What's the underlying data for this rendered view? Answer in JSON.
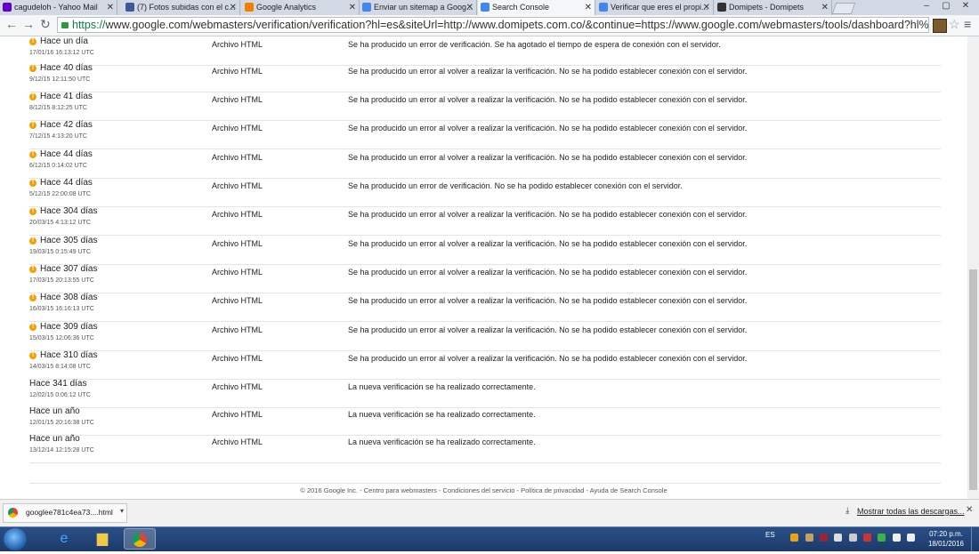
{
  "browser": {
    "tabs": [
      {
        "title": "cagudeloh - Yahoo Mail",
        "color": "#6001d2"
      },
      {
        "title": "(7) Fotos subidas con el c...",
        "color": "#3b5998"
      },
      {
        "title": "Google Analytics",
        "color": "#f57c00"
      },
      {
        "title": "Enviar un sitemap a Goog...",
        "color": "#4285f4"
      },
      {
        "title": "Search Console",
        "color": "#4285f4",
        "active": true
      },
      {
        "title": "Verificar que eres el propi...",
        "color": "#4285f4"
      },
      {
        "title": "Domipets - Domipets",
        "color": "#333333"
      }
    ],
    "url_scheme": "https://",
    "url_rest": "www.google.com/webmasters/verification/verification?hl=es&siteUrl=http://www.domipets.com.co/&continue=https://www.google.com/webmasters/tools/dashboard?hl%3Des%26authuser%"
  },
  "history": [
    {
      "warn": true,
      "age": "Hace un día",
      "ts": "17/01/16 16:13:12 UTC",
      "method": "Archivo HTML",
      "result": "Se ha producido un error de verificación. Se ha agotado el tiempo de espera de conexión con el servidor."
    },
    {
      "warn": true,
      "age": "Hace 40 días",
      "ts": "9/12/15 12:11:50 UTC",
      "method": "Archivo HTML",
      "result": "Se ha producido un error al volver a realizar la verificación. No se ha podido establecer conexión con el servidor."
    },
    {
      "warn": true,
      "age": "Hace 41 días",
      "ts": "8/12/15 8:12:25 UTC",
      "method": "Archivo HTML",
      "result": "Se ha producido un error al volver a realizar la verificación. No se ha podido establecer conexión con el servidor."
    },
    {
      "warn": true,
      "age": "Hace 42 días",
      "ts": "7/12/15 4:13:20 UTC",
      "method": "Archivo HTML",
      "result": "Se ha producido un error al volver a realizar la verificación. No se ha podido establecer conexión con el servidor."
    },
    {
      "warn": true,
      "age": "Hace 44 días",
      "ts": "6/12/15 0:14:02 UTC",
      "method": "Archivo HTML",
      "result": "Se ha producido un error al volver a realizar la verificación. No se ha podido establecer conexión con el servidor."
    },
    {
      "warn": true,
      "age": "Hace 44 días",
      "ts": "5/12/15 22:00:08 UTC",
      "method": "Archivo HTML",
      "result": "Se ha producido un error de verificación. No se ha podido establecer conexión con el servidor."
    },
    {
      "warn": true,
      "age": "Hace 304 días",
      "ts": "20/03/15 4:13:12 UTC",
      "method": "Archivo HTML",
      "result": "Se ha producido un error al volver a realizar la verificación. No se ha podido establecer conexión con el servidor."
    },
    {
      "warn": true,
      "age": "Hace 305 días",
      "ts": "19/03/15 0:15:49 UTC",
      "method": "Archivo HTML",
      "result": "Se ha producido un error al volver a realizar la verificación. No se ha podido establecer conexión con el servidor."
    },
    {
      "warn": true,
      "age": "Hace 307 días",
      "ts": "17/03/15 20:13:55 UTC",
      "method": "Archivo HTML",
      "result": "Se ha producido un error al volver a realizar la verificación. No se ha podido establecer conexión con el servidor."
    },
    {
      "warn": true,
      "age": "Hace 308 días",
      "ts": "16/03/15 16:16:13 UTC",
      "method": "Archivo HTML",
      "result": "Se ha producido un error al volver a realizar la verificación. No se ha podido establecer conexión con el servidor."
    },
    {
      "warn": true,
      "age": "Hace 309 días",
      "ts": "15/03/15 12:06:36 UTC",
      "method": "Archivo HTML",
      "result": "Se ha producido un error al volver a realizar la verificación. No se ha podido establecer conexión con el servidor."
    },
    {
      "warn": true,
      "age": "Hace 310 días",
      "ts": "14/03/15 8:14:08 UTC",
      "method": "Archivo HTML",
      "result": "Se ha producido un error al volver a realizar la verificación. No se ha podido establecer conexión con el servidor."
    },
    {
      "warn": false,
      "age": "Hace 341 días",
      "ts": "12/02/15 0:06:12 UTC",
      "method": "Archivo HTML",
      "result": "La nueva verificación se ha realizado correctamente."
    },
    {
      "warn": false,
      "age": "Hace un año",
      "ts": "12/01/15 20:16:38 UTC",
      "method": "Archivo HTML",
      "result": "La nueva verificación se ha realizado correctamente."
    },
    {
      "warn": false,
      "age": "Hace un año",
      "ts": "13/12/14 12:15:28 UTC",
      "method": "Archivo HTML",
      "result": "La nueva verificación se ha realizado correctamente."
    }
  ],
  "footer": "© 2016 Google Inc. - Centro para webmasters - Condiciones del servicio - Política de privacidad - Ayuda de Search Console",
  "downloads": {
    "file": "googlee781c4ea73....html",
    "show_all": "Mostrar todas las descargas..."
  },
  "taskbar": {
    "lang": "ES",
    "time": "07:20 p.m.",
    "date": "18/01/2016"
  }
}
